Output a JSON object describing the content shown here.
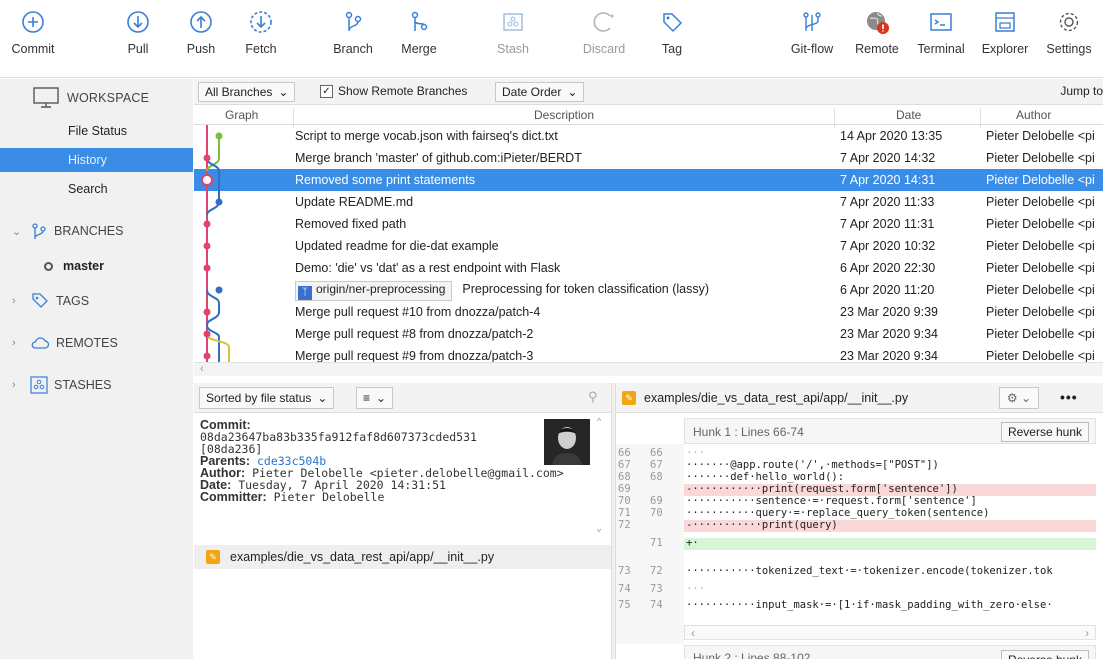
{
  "toolbar": {
    "commit": "Commit",
    "pull": "Pull",
    "push": "Push",
    "fetch": "Fetch",
    "branch": "Branch",
    "merge": "Merge",
    "stash": "Stash",
    "discard": "Discard",
    "tag": "Tag",
    "gitflow": "Git-flow",
    "remote": "Remote",
    "terminal": "Terminal",
    "explorer": "Explorer",
    "settings": "Settings"
  },
  "sidebar": {
    "workspace": "WORKSPACE",
    "file_status": "File Status",
    "history": "History",
    "search": "Search",
    "branches": "BRANCHES",
    "master": "master",
    "tags": "TAGS",
    "remotes": "REMOTES",
    "stashes": "STASHES"
  },
  "filterbar": {
    "all_branches": "All Branches",
    "show_remote": "Show Remote Branches",
    "date_order": "Date Order",
    "jump_to": "Jump to"
  },
  "columns": {
    "graph": "Graph",
    "description": "Description",
    "date": "Date",
    "author": "Author"
  },
  "commits": [
    {
      "desc": "Script to merge vocab.json with fairseq's dict.txt",
      "date": "14 Apr 2020 13:35",
      "author": "Pieter Delobelle <pi"
    },
    {
      "desc": "Merge branch 'master' of github.com:iPieter/BERDT",
      "date": "7 Apr 2020 14:32",
      "author": "Pieter Delobelle <pi"
    },
    {
      "desc": "Removed some print statements",
      "date": "7 Apr 2020 14:31",
      "author": "Pieter Delobelle <pi"
    },
    {
      "desc": "Update README.md",
      "date": "7 Apr 2020 11:33",
      "author": "Pieter Delobelle <pi"
    },
    {
      "desc": "Removed fixed path",
      "date": "7 Apr 2020 11:31",
      "author": "Pieter Delobelle <pi"
    },
    {
      "desc": "Updated readme for die-dat example",
      "date": "7 Apr 2020 10:32",
      "author": "Pieter Delobelle <pi"
    },
    {
      "desc": "Demo: 'die' vs 'dat' as a rest endpoint with Flask",
      "date": "6 Apr 2020 22:30",
      "author": "Pieter Delobelle <pi"
    },
    {
      "tag": "origin/ner-preprocessing",
      "desc": "Preprocessing for token classification (lassy)",
      "date": "6 Apr 2020 11:20",
      "author": "Pieter Delobelle <pi"
    },
    {
      "desc": "Merge pull request #10 from dnozza/patch-4",
      "date": "23 Mar 2020 9:39",
      "author": "Pieter Delobelle <pi"
    },
    {
      "desc": "Merge pull request #8 from dnozza/patch-2",
      "date": "23 Mar 2020 9:34",
      "author": "Pieter Delobelle <pi"
    },
    {
      "desc": "Merge pull request #9 from dnozza/patch-3",
      "date": "23 Mar 2020 9:34",
      "author": "Pieter Delobelle <pi"
    }
  ],
  "details": {
    "sort_label": "Sorted by file status",
    "commit_label": "Commit:",
    "commit_hash": "08da23647ba83b335fa912faf8d607373cded531",
    "short_hash": "[08da236]",
    "parents_label": "Parents:",
    "parents_value": "cde33c504b",
    "author_label": "Author:",
    "author_value": "Pieter Delobelle <pieter.delobelle@gmail.com>",
    "date_label": "Date:",
    "date_value": "Tuesday, 7 April 2020 14:31:51",
    "committer_label": "Committer:",
    "committer_value": "Pieter Delobelle",
    "file": "examples/die_vs_data_rest_api/app/__init__.py"
  },
  "diff": {
    "file": "examples/die_vs_data_rest_api/app/__init__.py",
    "hunk1": "Hunk 1 : Lines 66-74",
    "reverse": "Reverse hunk",
    "hunk2": "Hunk 2 : Lines 88-102",
    "lines": [
      {
        "o": "66",
        "n": "66",
        "code": "···",
        "t": ""
      },
      {
        "o": "67",
        "n": "67",
        "code": "·······@app.route('/',·methods=[\"POST\"])",
        "t": ""
      },
      {
        "o": "68",
        "n": "68",
        "code": "·······def·hello_world():",
        "t": ""
      },
      {
        "o": "69",
        "n": "",
        "code": "-···········print(request.form['sentence'])",
        "t": "del"
      },
      {
        "o": "70",
        "n": "69",
        "code": "···········sentence·=·request.form['sentence']",
        "t": ""
      },
      {
        "o": "71",
        "n": "70",
        "code": "···········query·=·replace_query_token(sentence)",
        "t": ""
      },
      {
        "o": "72",
        "n": "",
        "code": "-···········print(query)",
        "t": "del"
      },
      {
        "o": "",
        "n": "71",
        "code": "+·",
        "t": "add"
      },
      {
        "o": "73",
        "n": "72",
        "code": "···········tokenized_text·=·tokenizer.encode(tokenizer.tok",
        "t": ""
      },
      {
        "o": "74",
        "n": "73",
        "code": "···",
        "t": ""
      },
      {
        "o": "75",
        "n": "74",
        "code": "···········input_mask·=·[1·if·mask_padding_with_zero·else·",
        "t": ""
      }
    ]
  },
  "colors": {
    "accent": "#3a8de6",
    "graph_pink": "#e0436e",
    "graph_green": "#7cbd3b",
    "graph_blue": "#2f6fc4",
    "graph_yellow": "#d8c23a"
  }
}
